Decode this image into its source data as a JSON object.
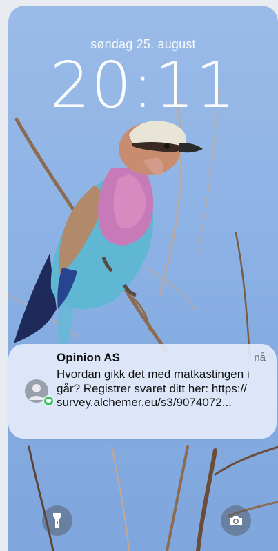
{
  "lockscreen": {
    "date": "søndag 25. august",
    "time": "20:11"
  },
  "notification": {
    "sender": "Opinion AS",
    "time": "nå",
    "body": "Hvordan gikk det med matkastingen i går? Registrer svaret ditt her: https:// survey.alchemer.eu/s3/9074072...",
    "avatar_icon": "person-icon",
    "badge_icon": "messages-icon",
    "badge_color": "#35c759"
  },
  "quick_actions": {
    "left_icon": "flashlight-icon",
    "right_icon": "camera-icon"
  }
}
